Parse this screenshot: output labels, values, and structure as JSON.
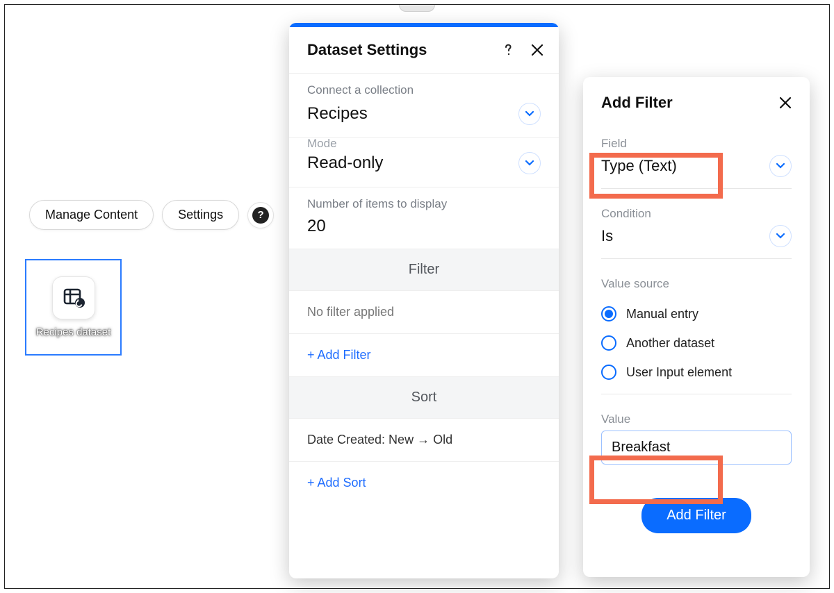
{
  "toolbar": {
    "manage_content": "Manage Content",
    "settings": "Settings"
  },
  "tile": {
    "label": "Recipes dataset"
  },
  "settings_panel": {
    "title": "Dataset Settings",
    "connect_label": "Connect a collection",
    "connect_value": "Recipes",
    "mode_label_cut": "Mode",
    "mode_value": "Read-only",
    "items_label": "Number of items to display",
    "items_value": "20",
    "filter_heading": "Filter",
    "filter_status": "No filter applied",
    "add_filter": "+ Add Filter",
    "sort_heading": "Sort",
    "sort_value": "Date Created: New → Old",
    "add_sort": "+ Add Sort"
  },
  "filter_panel": {
    "title": "Add Filter",
    "field_label": "Field",
    "field_value": "Type (Text)",
    "condition_label": "Condition",
    "condition_value": "Is",
    "value_source_label": "Value source",
    "radios": {
      "manual": "Manual entry",
      "another": "Another dataset",
      "user_input": "User Input element"
    },
    "value_label": "Value",
    "value_input": "Breakfast",
    "submit": "Add Filter"
  }
}
